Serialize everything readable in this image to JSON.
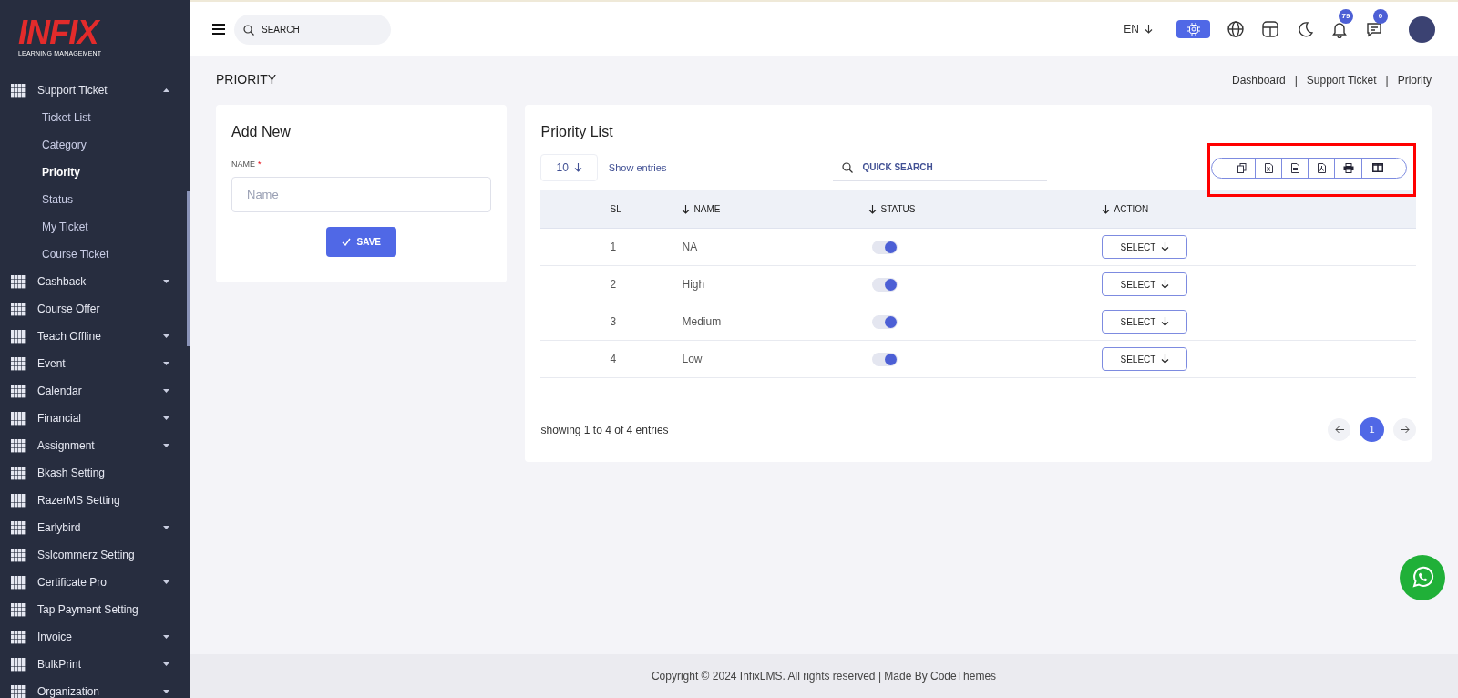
{
  "logo": {
    "brand": "INFIX",
    "tagline": "LEARNING MANAGEMENT"
  },
  "sidebar": {
    "items": [
      {
        "label": "Support Ticket",
        "kind": "menu",
        "expanded": true,
        "children": [
          {
            "label": "Ticket List",
            "selected": false
          },
          {
            "label": "Category",
            "selected": false
          },
          {
            "label": "Priority",
            "selected": true
          },
          {
            "label": "Status",
            "selected": false
          },
          {
            "label": "My Ticket",
            "selected": false
          },
          {
            "label": "Course Ticket",
            "selected": false
          }
        ]
      },
      {
        "label": "Cashback",
        "kind": "menu",
        "expanded": false
      },
      {
        "label": "Course Offer",
        "kind": "link"
      },
      {
        "label": "Teach Offline",
        "kind": "menu",
        "expanded": false
      },
      {
        "label": "Event",
        "kind": "menu",
        "expanded": false
      },
      {
        "label": "Calendar",
        "kind": "menu",
        "expanded": false
      },
      {
        "label": "Financial",
        "kind": "menu",
        "expanded": false
      },
      {
        "label": "Assignment",
        "kind": "menu",
        "expanded": false
      },
      {
        "label": "Bkash Setting",
        "kind": "link"
      },
      {
        "label": "RazerMS Setting",
        "kind": "link"
      },
      {
        "label": "Earlybird",
        "kind": "menu",
        "expanded": false
      },
      {
        "label": "Sslcommerz Setting",
        "kind": "link"
      },
      {
        "label": "Certificate Pro",
        "kind": "menu",
        "expanded": false
      },
      {
        "label": "Tap Payment Setting",
        "kind": "link"
      },
      {
        "label": "Invoice",
        "kind": "menu",
        "expanded": false
      },
      {
        "label": "BulkPrint",
        "kind": "menu",
        "expanded": false
      },
      {
        "label": "Organization",
        "kind": "menu",
        "expanded": false
      }
    ]
  },
  "header": {
    "search_placeholder": "SEARCH",
    "language": "EN",
    "notifications": "79",
    "messages": "0"
  },
  "page_title": "PRIORITY",
  "breadcrumbs": [
    "Dashboard",
    "Support Ticket",
    "Priority"
  ],
  "breadcrumb_separator": "|",
  "add_form": {
    "title": "Add New",
    "field_label": "NAME",
    "required_mark": "*",
    "placeholder": "Name",
    "save": "SAVE"
  },
  "list": {
    "title": "Priority List",
    "page_size": "10",
    "show_entries": "Show entries",
    "search_placeholder": "QUICK SEARCH",
    "columns": [
      "SL",
      "NAME",
      "STATUS",
      "ACTION"
    ],
    "rows": [
      {
        "sl": "1",
        "name": "NA",
        "on": true,
        "action": "SELECT"
      },
      {
        "sl": "2",
        "name": "High",
        "on": true,
        "action": "SELECT"
      },
      {
        "sl": "3",
        "name": "Medium",
        "on": true,
        "action": "SELECT"
      },
      {
        "sl": "4",
        "name": "Low",
        "on": true,
        "action": "SELECT"
      }
    ],
    "summary": "showing 1 to 4 of 4 entries",
    "pages": [
      {
        "label": "1",
        "selected": true
      }
    ]
  },
  "footer": "Copyright © 2024 InfixLMS. All rights reserved | Made By CodeThemes"
}
